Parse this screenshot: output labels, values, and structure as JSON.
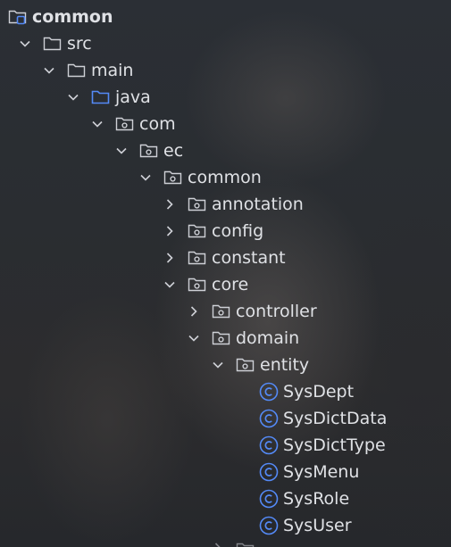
{
  "project_tree": {
    "root": {
      "label": "common",
      "icon": "module-folder-icon",
      "expanded": true
    },
    "nodes": [
      {
        "label": "src",
        "icon": "folder-icon",
        "expanded": true
      },
      {
        "label": "main",
        "icon": "folder-icon",
        "expanded": true
      },
      {
        "label": "java",
        "icon": "source-root-folder-icon",
        "expanded": true
      },
      {
        "label": "com",
        "icon": "package-folder-icon",
        "expanded": true
      },
      {
        "label": "ec",
        "icon": "package-folder-icon",
        "expanded": true
      },
      {
        "label": "common",
        "icon": "package-folder-icon",
        "expanded": true
      },
      {
        "label": "annotation",
        "icon": "package-folder-icon",
        "expanded": false
      },
      {
        "label": "config",
        "icon": "package-folder-icon",
        "expanded": false
      },
      {
        "label": "constant",
        "icon": "package-folder-icon",
        "expanded": false
      },
      {
        "label": "core",
        "icon": "package-folder-icon",
        "expanded": true
      },
      {
        "label": "controller",
        "icon": "package-folder-icon",
        "expanded": false
      },
      {
        "label": "domain",
        "icon": "package-folder-icon",
        "expanded": true
      },
      {
        "label": "entity",
        "icon": "package-folder-icon",
        "expanded": true
      }
    ],
    "classes": [
      "SysDept",
      "SysDictData",
      "SysDictType",
      "SysMenu",
      "SysRole",
      "SysUser"
    ],
    "class_icon": "java-class-icon",
    "colors": {
      "text": "#dfe1e5",
      "icon_stroke": "#ced0d6",
      "source_root_blue": "#548af7",
      "class_icon_blue": "#548af7"
    }
  }
}
